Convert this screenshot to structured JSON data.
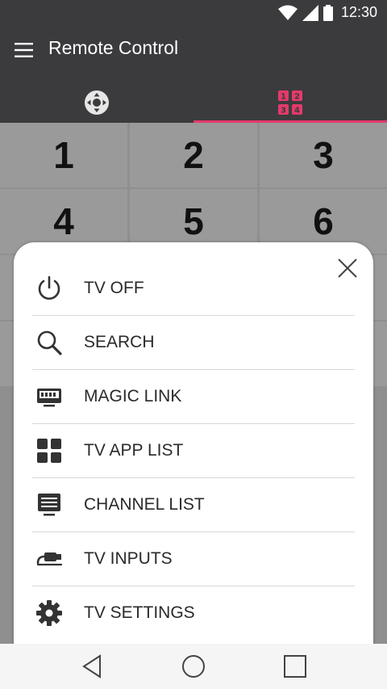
{
  "status_bar": {
    "time": "12:30",
    "icons": [
      "wifi-icon",
      "signal-icon",
      "battery-icon"
    ]
  },
  "app_bar": {
    "title": "Remote Control",
    "menu_icon": "hamburger-menu-icon"
  },
  "tabs": [
    {
      "name": "dpad",
      "icon": "dpad-icon",
      "selected": false
    },
    {
      "name": "numpad",
      "icon": "numpad-icon",
      "selected": true,
      "glyphs": [
        "1",
        "2",
        "3",
        "4"
      ]
    }
  ],
  "numpad": {
    "keys": [
      "1",
      "2",
      "3",
      "4",
      "5",
      "6"
    ]
  },
  "menu": {
    "close_icon": "close-icon",
    "items": [
      {
        "icon": "power-icon",
        "label": "TV OFF"
      },
      {
        "icon": "search-icon",
        "label": "SEARCH"
      },
      {
        "icon": "magic-link-icon",
        "label": "MAGIC LINK"
      },
      {
        "icon": "app-grid-icon",
        "label": "TV APP LIST"
      },
      {
        "icon": "channel-list-icon",
        "label": "CHANNEL LIST"
      },
      {
        "icon": "input-cable-icon",
        "label": "TV INPUTS"
      },
      {
        "icon": "gear-icon",
        "label": "TV SETTINGS"
      }
    ]
  },
  "colors": {
    "accent": "#e43a6b",
    "header": "#3b3b3d",
    "icon": "#333333"
  },
  "nav_bar": {
    "icons": [
      "back-icon",
      "home-icon",
      "recent-apps-icon"
    ]
  }
}
